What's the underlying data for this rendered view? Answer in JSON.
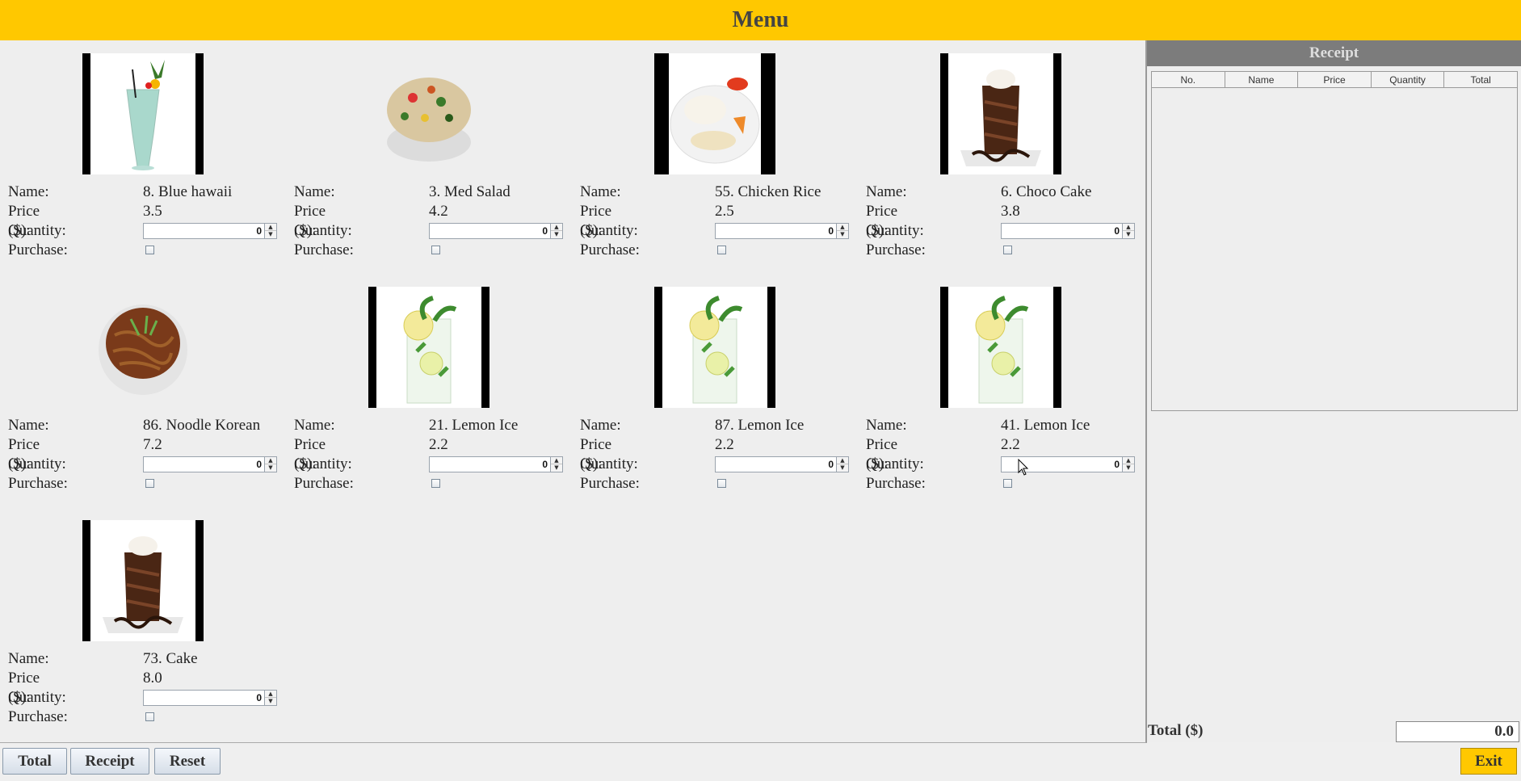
{
  "header": {
    "title": "Menu"
  },
  "labels": {
    "name": "Name:",
    "price": "Price ($):",
    "quantity": "Quantity:",
    "purchase": "Purchase:"
  },
  "items": [
    {
      "name": "8. Blue hawaii",
      "price": "3.5",
      "quantity": "0",
      "purchased": false,
      "image": "blue-hawaii-drink"
    },
    {
      "name": "3. Med Salad",
      "price": "4.2",
      "quantity": "0",
      "purchased": false,
      "image": "salad-bowl"
    },
    {
      "name": "55. Chicken Rice",
      "price": "2.5",
      "quantity": "0",
      "purchased": false,
      "image": "chicken-rice-plate"
    },
    {
      "name": "6. Choco Cake",
      "price": "3.8",
      "quantity": "0",
      "purchased": false,
      "image": "chocolate-cake-slice"
    },
    {
      "name": "86. Noodle Korean",
      "price": "7.2",
      "quantity": "0",
      "purchased": false,
      "image": "noodle-bowl"
    },
    {
      "name": "21. Lemon Ice",
      "price": "2.2",
      "quantity": "0",
      "purchased": false,
      "image": "lemon-ice-drink"
    },
    {
      "name": "87. Lemon Ice",
      "price": "2.2",
      "quantity": "0",
      "purchased": false,
      "image": "lemon-ice-drink"
    },
    {
      "name": "41. Lemon Ice",
      "price": "2.2",
      "quantity": "0",
      "purchased": false,
      "image": "lemon-ice-drink"
    },
    {
      "name": "73. Cake",
      "price": "8.0",
      "quantity": "0",
      "purchased": false,
      "image": "chocolate-cake-slice"
    }
  ],
  "receipt": {
    "title": "Receipt",
    "columns": [
      "No.",
      "Name",
      "Price",
      "Quantity",
      "Total"
    ],
    "rows": []
  },
  "total": {
    "label": "Total ($)",
    "value": "0.0"
  },
  "buttons": {
    "total": "Total",
    "receipt": "Receipt",
    "reset": "Reset",
    "exit": "Exit"
  },
  "colors": {
    "accent": "#ffc800",
    "receipt_header": "#7c7c7c",
    "background": "#eeeeee"
  }
}
